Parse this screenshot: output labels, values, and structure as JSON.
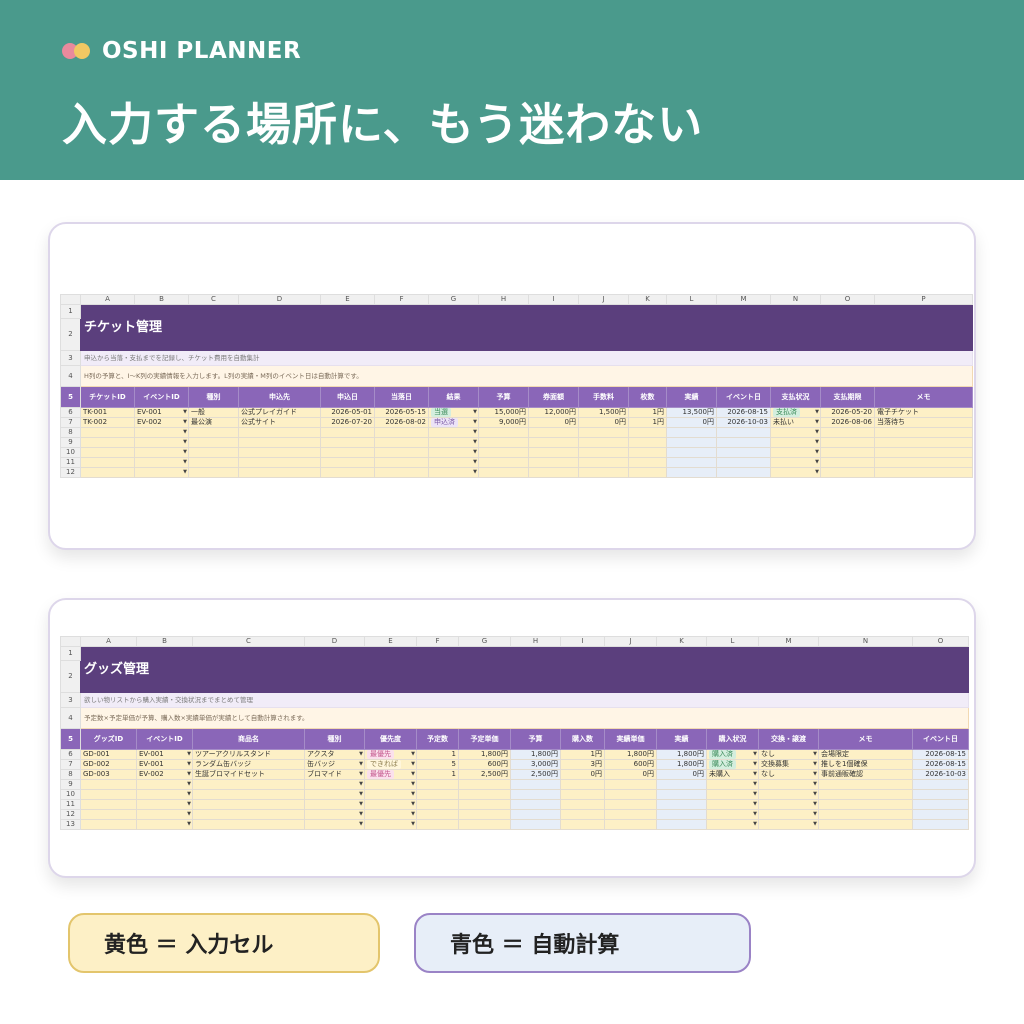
{
  "brand": {
    "name": "OSHI PLANNER",
    "logo_icon": "two-dots-logo-icon",
    "colors": {
      "pink": "#e98a9d",
      "yellow": "#f1c863"
    }
  },
  "headline": "入力する場所に、もう迷わない",
  "colors": {
    "banner": "#4a9a8c",
    "title_bar": "#5b3f7d",
    "header": "#8a66b8",
    "input_yellow": "#fdf0c6",
    "auto_blue": "#e7eef8"
  },
  "ticket_sheet": {
    "columns": [
      "A",
      "B",
      "C",
      "D",
      "E",
      "F",
      "G",
      "H",
      "I",
      "J",
      "K",
      "L",
      "M",
      "N",
      "O",
      "P"
    ],
    "title": "チケット管理",
    "description": "申込から当落・支払までを記録し、チケット費用を自動集計",
    "note": "H列の予算と、I〜K列の実績情報を入力します。L列の実績・M列のイベント日は自動計算です。",
    "headers": [
      "チケットID",
      "イベントID",
      "種別",
      "申込先",
      "申込日",
      "当落日",
      "結果",
      "予算",
      "券面額",
      "手数料",
      "枚数",
      "実績",
      "イベント日",
      "支払状況",
      "支払期限",
      "メモ"
    ],
    "rows": [
      {
        "id": "TK-001",
        "event_id": "EV-001",
        "type": "一般",
        "dest": "公式プレイガイド",
        "apply_date": "2026-05-01",
        "result_date": "2026-05-15",
        "result": "当選",
        "budget": "15,000円",
        "face": "12,000円",
        "fee": "1,500円",
        "count": "1円",
        "actual": "13,500円",
        "event_date": "2026-08-15",
        "pay_status": "支払済",
        "deadline": "2026-05-20",
        "memo": "電子チケット"
      },
      {
        "id": "TK-002",
        "event_id": "EV-002",
        "type": "最公演",
        "dest": "公式サイト",
        "apply_date": "2026-07-20",
        "result_date": "2026-08-02",
        "result": "申込済",
        "budget": "9,000円",
        "face": "0円",
        "fee": "0円",
        "count": "1円",
        "actual": "0円",
        "event_date": "2026-10-03",
        "pay_status": "未払い",
        "deadline": "2026-08-06",
        "memo": "当落待ち"
      }
    ],
    "row_numbers": [
      "1",
      "2",
      "3",
      "4",
      "5",
      "6",
      "7",
      "8",
      "9",
      "10",
      "11",
      "12"
    ]
  },
  "goods_sheet": {
    "columns": [
      "A",
      "B",
      "C",
      "D",
      "E",
      "F",
      "G",
      "H",
      "I",
      "J",
      "K",
      "L",
      "M",
      "N",
      "O"
    ],
    "title": "グッズ管理",
    "description": "欲しい物リストから購入実績・交換状況までまとめて管理",
    "note": "予定数×予定単価が予算、購入数×実績単価が実績として自動計算されます。",
    "headers": [
      "グッズID",
      "イベントID",
      "商品名",
      "種別",
      "優先度",
      "予定数",
      "予定単価",
      "予算",
      "購入数",
      "実績単価",
      "実績",
      "購入状況",
      "交換・譲渡",
      "メモ",
      "イベント日"
    ],
    "rows": [
      {
        "id": "GD-001",
        "event_id": "EV-001",
        "name": "ツアーアクリルスタンド",
        "type": "アクスタ",
        "priority": "最優先",
        "plan_qty": "1",
        "plan_price": "1,800円",
        "budget": "1,800円",
        "buy_qty": "1円",
        "act_price": "1,800円",
        "actual": "1,800円",
        "status": "購入済",
        "exchange": "なし",
        "memo": "会場限定",
        "event_date": "2026-08-15"
      },
      {
        "id": "GD-002",
        "event_id": "EV-001",
        "name": "ランダム缶バッジ",
        "type": "缶バッジ",
        "priority": "できれば",
        "plan_qty": "5",
        "plan_price": "600円",
        "budget": "3,000円",
        "buy_qty": "3円",
        "act_price": "600円",
        "actual": "1,800円",
        "status": "購入済",
        "exchange": "交換募集",
        "memo": "推しを1個確保",
        "event_date": "2026-08-15"
      },
      {
        "id": "GD-003",
        "event_id": "EV-002",
        "name": "生誕ブロマイドセット",
        "type": "ブロマイド",
        "priority": "最優先",
        "plan_qty": "1",
        "plan_price": "2,500円",
        "budget": "2,500円",
        "buy_qty": "0円",
        "act_price": "0円",
        "actual": "0円",
        "status": "未購入",
        "exchange": "なし",
        "memo": "事前通販確認",
        "event_date": "2026-10-03"
      }
    ],
    "row_numbers": [
      "1",
      "2",
      "3",
      "4",
      "5",
      "6",
      "7",
      "8",
      "9",
      "10",
      "11",
      "12",
      "13"
    ]
  },
  "legend": {
    "yellow": "黄色 ＝ 入力セル",
    "blue": "青色 ＝ 自動計算"
  }
}
